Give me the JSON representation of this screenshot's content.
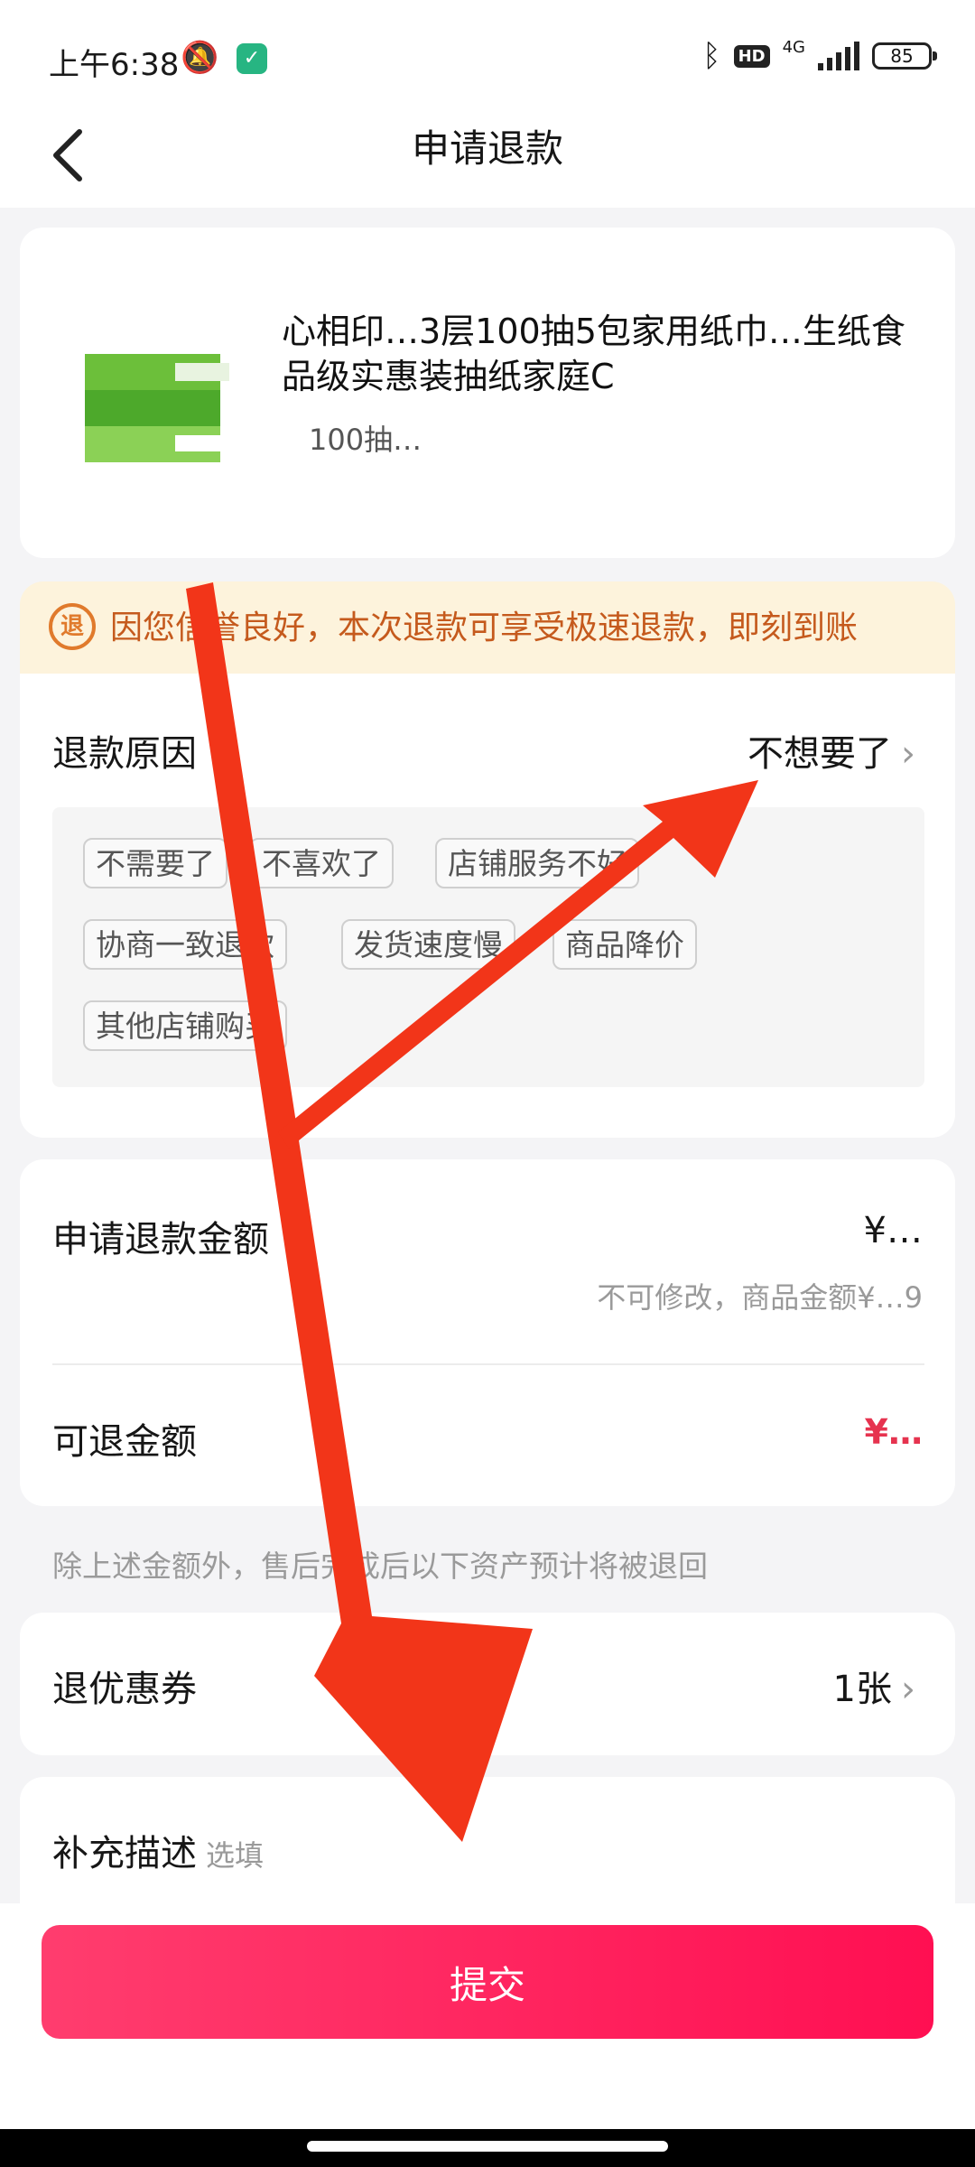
{
  "status_bar": {
    "time": "上午6:38",
    "network": "4G",
    "battery": "85",
    "hd": "HD"
  },
  "header": {
    "title": "申请退款"
  },
  "product": {
    "title": "心相印…3层100抽5包家用纸巾…生纸食品级实惠装抽纸家庭C",
    "spec": "100抽…"
  },
  "notice": {
    "icon_text": "退",
    "text": "因您信誉良好，本次退款可享受极速退款，即刻到账"
  },
  "refund_reason": {
    "label": "退款原因",
    "selected": "不想要了",
    "options": [
      "不需要了",
      "不喜欢了",
      "店铺服务不好",
      "协商一致退款",
      "发货速度慢",
      "商品降价",
      "其他店铺购买"
    ]
  },
  "amount": {
    "label": "申请退款金额",
    "value": "¥…",
    "hint": "不可修改，商品金额¥…9",
    "refundable_label": "可退金额",
    "refundable_value": "¥…"
  },
  "extra_hint": "除上述金额外，售后完成后以下资产预计将被退回",
  "coupon": {
    "label": "退优惠券",
    "value": "1张"
  },
  "description": {
    "label": "补充描述",
    "placeholder": "选填"
  },
  "submit": {
    "label": "提交"
  },
  "colors": {
    "accent": "#ff1f5a",
    "notice_bg": "#fdf3dc",
    "notice_text": "#c55a1d",
    "annotation_arrow": "#f23519"
  }
}
